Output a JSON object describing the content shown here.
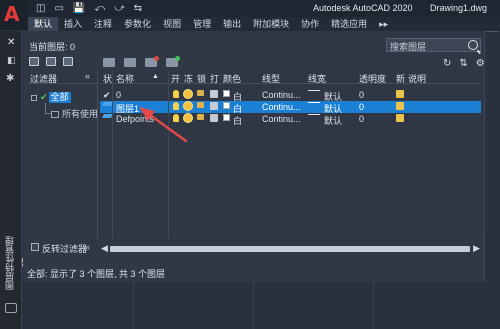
{
  "titlebar": {
    "app_name": "Autodesk AutoCAD 2020",
    "document": "Drawing1.dwg",
    "quick_access": [
      "◫",
      "▭",
      "💾",
      "⤺",
      "⤻",
      "⇆"
    ]
  },
  "ribbon_tabs": [
    "默认",
    "插入",
    "注释",
    "参数化",
    "视图",
    "管理",
    "输出",
    "附加模块",
    "协作",
    "精选应用",
    "▸▸"
  ],
  "palette": {
    "vertical_title": "图层特性管理器"
  },
  "panel": {
    "current_layer": "当前图层: 0",
    "search_placeholder": "搜索图层"
  },
  "filter_pane": {
    "header": "过滤器",
    "collapse": "«",
    "all": "全部",
    "used": "所有使用的图层",
    "invert_label": "反转过滤器",
    "invert_collapse": "«"
  },
  "grid": {
    "headers": {
      "status": "状",
      "name": "名称",
      "sort": "▲",
      "on": "开",
      "freeze": "冻",
      "lock": "锁",
      "plot": "打",
      "color": "颜色",
      "linetype": "线型",
      "lineweight": "线宽",
      "transparency": "透明度",
      "new_vp_freeze": "新",
      "description": "说明"
    },
    "rows": [
      {
        "name": "0",
        "color": "白",
        "linetype": "Continu...",
        "lineweight": "默认",
        "transparency": "0",
        "selected": false,
        "current": true
      },
      {
        "name": "图层1",
        "color": "白",
        "linetype": "Continu...",
        "lineweight": "默认",
        "transparency": "0",
        "selected": true,
        "current": false
      },
      {
        "name": "Defpoints",
        "color": "白",
        "linetype": "Continu...",
        "lineweight": "默认",
        "transparency": "0",
        "selected": false,
        "current": false
      }
    ]
  },
  "scroll": {
    "left": "◀",
    "right": "▶"
  },
  "status_text": "全部: 显示了 3 个图层, 共 3 个图层",
  "colors": {
    "selection": "#1b7fd4",
    "annotation_arrow": "#e24a4a",
    "app_logo": "#e23b3b"
  }
}
